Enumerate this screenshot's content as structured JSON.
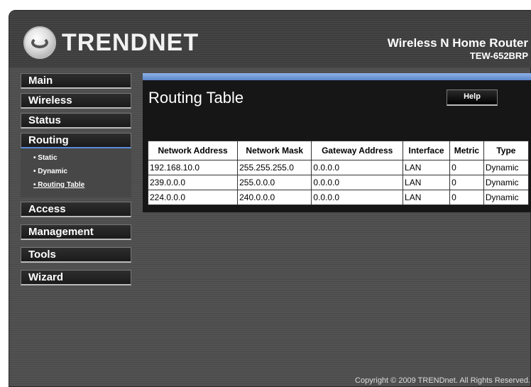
{
  "header": {
    "logo_text": "TRENDNET",
    "product_name": "Wireless N Home Router",
    "product_model": "TEW-652BRP"
  },
  "sidebar": {
    "items": [
      {
        "label": "Main"
      },
      {
        "label": "Wireless"
      },
      {
        "label": "Status"
      },
      {
        "label": "Routing"
      },
      {
        "label": "Access"
      },
      {
        "label": "Management"
      },
      {
        "label": "Tools"
      },
      {
        "label": "Wizard"
      }
    ],
    "routing_sub": [
      {
        "label": "• Static"
      },
      {
        "label": "• Dynamic"
      },
      {
        "label": "• Routing Table"
      }
    ]
  },
  "content": {
    "title": "Routing Table",
    "help_label": "Help",
    "table": {
      "headers": [
        "Network Address",
        "Network Mask",
        "Gateway Address",
        "Interface",
        "Metric",
        "Type"
      ],
      "rows": [
        [
          "192.168.10.0",
          "255.255.255.0",
          "0.0.0.0",
          "LAN",
          "0",
          "Dynamic"
        ],
        [
          "239.0.0.0",
          "255.0.0.0",
          "0.0.0.0",
          "LAN",
          "0",
          "Dynamic"
        ],
        [
          "224.0.0.0",
          "240.0.0.0",
          "0.0.0.0",
          "LAN",
          "0",
          "Dynamic"
        ]
      ]
    }
  },
  "footer": {
    "copyright": "Copyright © 2009 TRENDnet. All Rights Reserved."
  }
}
